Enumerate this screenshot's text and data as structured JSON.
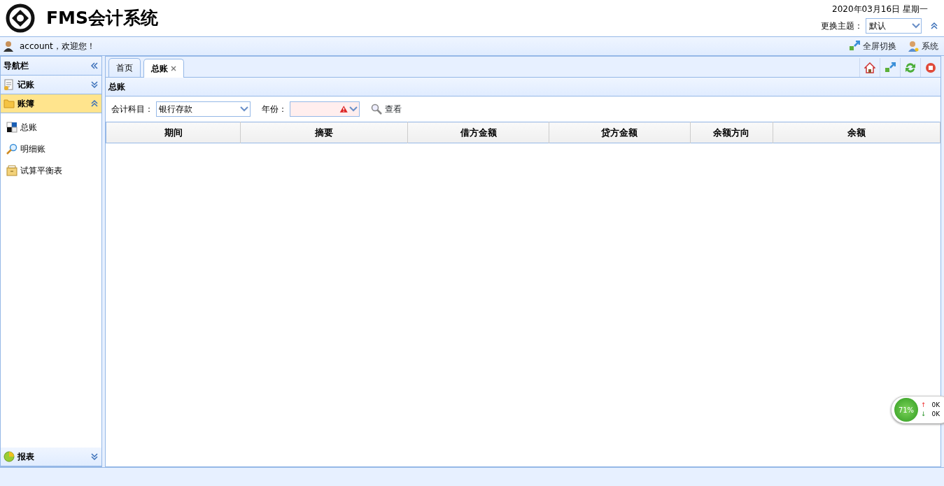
{
  "app": {
    "title": "FMS会计系统",
    "date": "2020年03月16日 星期一",
    "theme_label": "更换主题：",
    "theme_value": "默认"
  },
  "user_bar": {
    "greeting": "account，欢迎您！",
    "actions": [
      {
        "label": "全屏切换",
        "kind": "fullscreen"
      },
      {
        "label": "系统",
        "kind": "system"
      }
    ]
  },
  "sidebar": {
    "title": "导航栏",
    "sections": [
      {
        "label": "记账",
        "kind": "doc",
        "expanded": false,
        "selected": false
      },
      {
        "label": "账簿",
        "kind": "folder",
        "expanded": true,
        "selected": true,
        "items": [
          {
            "label": "总账",
            "kind": "ledger"
          },
          {
            "label": "明细账",
            "kind": "search"
          },
          {
            "label": "试算平衡表",
            "kind": "box"
          }
        ]
      },
      {
        "label": "报表",
        "kind": "report",
        "expanded": false,
        "selected": false
      }
    ]
  },
  "tabs": [
    {
      "label": "首页",
      "selected": false,
      "closable": false
    },
    {
      "label": "总账",
      "selected": true,
      "closable": true
    }
  ],
  "tab_tools": [
    {
      "kind": "home"
    },
    {
      "kind": "fullscreen"
    },
    {
      "kind": "refresh"
    },
    {
      "kind": "stop"
    }
  ],
  "panel": {
    "title": "总账",
    "filters": [
      {
        "label": "会计科目：",
        "value": "银行存款",
        "invalid": false
      },
      {
        "label": "年份：",
        "invalid": true
      }
    ],
    "search_button": "查看"
  },
  "table": {
    "columns": [
      "期间",
      "摘要",
      "借方金额",
      "贷方金额",
      "余额方向",
      "余额"
    ]
  },
  "speed_widget": {
    "percent": "71%",
    "upload_arrow": "↑",
    "upload": "0K",
    "download_arrow": "↓",
    "download": "0K"
  }
}
